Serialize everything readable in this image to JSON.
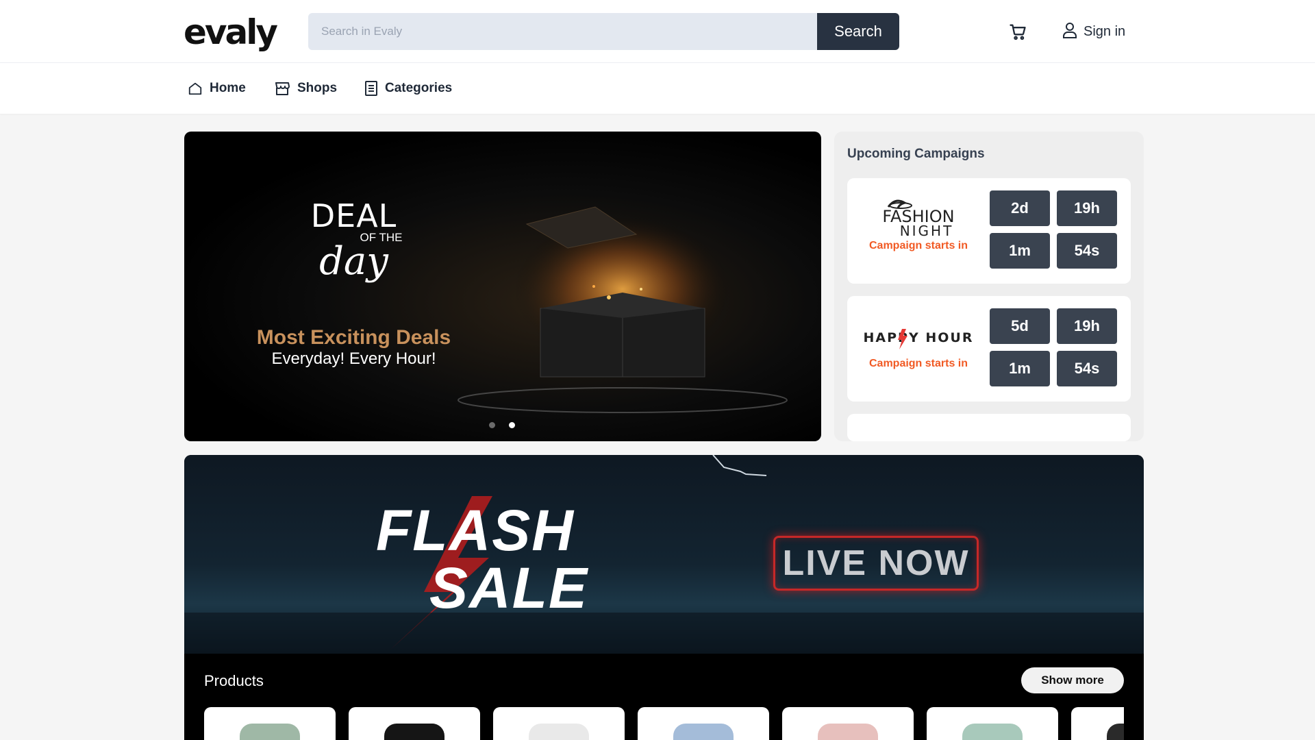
{
  "header": {
    "logo": "evaly",
    "search_placeholder": "Search in Evaly",
    "search_button": "Search",
    "signin_label": "Sign in"
  },
  "nav": {
    "items": [
      {
        "label": "Home",
        "icon": "home-icon"
      },
      {
        "label": "Shops",
        "icon": "shop-icon"
      },
      {
        "label": "Categories",
        "icon": "categories-icon"
      }
    ]
  },
  "hero": {
    "deal": "DEAL",
    "of_the": "OF THE",
    "day": "day",
    "headline": "Most Exciting Deals",
    "subline": "Everyday! Every Hour!",
    "active_slide": 2,
    "slide_count": 2
  },
  "campaigns": {
    "title": "Upcoming Campaigns",
    "items": [
      {
        "logo_line1": "FASHION",
        "logo_line2": "NIGHT",
        "starts_label": "Campaign starts in",
        "days": "2d",
        "hours": "19h",
        "minutes": "1m",
        "seconds": "54s"
      },
      {
        "logo_text": "HAPPY HOUR",
        "starts_label": "Campaign starts in",
        "days": "5d",
        "hours": "19h",
        "minutes": "1m",
        "seconds": "54s"
      }
    ]
  },
  "flash": {
    "line1": "FLASH",
    "line2": "SALE",
    "live": "LIVE NOW",
    "products_title": "Products",
    "show_more": "Show more",
    "product_colors": [
      "#9fb8a6",
      "#151515",
      "#e9e9e9",
      "#a4bcd9",
      "#e7c0bd",
      "#a8c9bb",
      "#2a2a2a"
    ]
  },
  "colors": {
    "accent": "#f15a24",
    "dark_button": "#283241",
    "timer_bg": "#3a4350"
  }
}
